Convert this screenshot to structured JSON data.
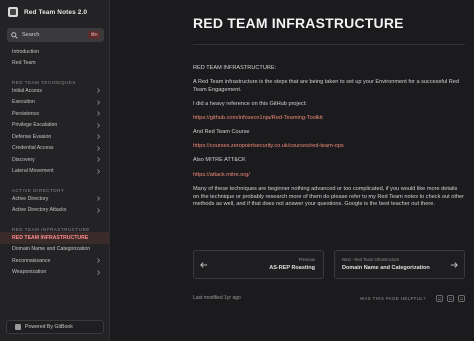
{
  "app": {
    "title": "Red Team Notes 2.0"
  },
  "search": {
    "label": "Search",
    "shortcut": "⌘K"
  },
  "sidebar": {
    "top_items": [
      {
        "label": "Introduction"
      },
      {
        "label": "Red Team"
      }
    ],
    "sections": [
      {
        "title": "RED TEAM TECHNIQUES",
        "items": [
          {
            "label": "Initial Access"
          },
          {
            "label": "Execution"
          },
          {
            "label": "Persistence"
          },
          {
            "label": "Privilege Escalation"
          },
          {
            "label": "Defense Evasion"
          },
          {
            "label": "Credential Access"
          },
          {
            "label": "Discovery"
          },
          {
            "label": "Lateral Movement"
          }
        ]
      },
      {
        "title": "ACTIVE DIRECTORY",
        "items": [
          {
            "label": "Active Directory"
          },
          {
            "label": "Active Directory Attacks"
          }
        ]
      },
      {
        "title": "RED TEAM INFRASTRUCTURE",
        "items": [
          {
            "label": "RED TEAM INFRASTRUCTURE",
            "active": true
          },
          {
            "label": "Domain Name and Categorization"
          },
          {
            "label": "Reconnaissance"
          },
          {
            "label": "Weaponization"
          }
        ]
      }
    ],
    "powered_by": "Powered By GitBook"
  },
  "page": {
    "title": "RED TEAM INFRASTRUCTURE",
    "paragraphs": [
      "RED TEAM INFRASTRUCTURE:",
      "A Red Team infrastructure is the steps that are being taken to set up your Environment for a successful Red Team Engagement.",
      "I did a heavy reference on this GitHub project:",
      "https://github.com/infosecn1nja/Red-Teaming-Toolkit",
      "And Red Team Course",
      "https://courses.zeropointsecurity.co.uk/courses/red-team-ops",
      "Also MITRE ATT&CK",
      "https://attack.mitre.org/",
      "Many of these techniques are beginner nothing advanced or too complicated, if you would like more details on the technique or probably research more of them do please refer to my Red Team notes to check out other methods as well, and if that does not answer your questions. Google is the best teacher out there."
    ]
  },
  "pager": {
    "prev": {
      "meta": "Previous",
      "title": "AS-REP Roasting"
    },
    "next": {
      "meta": "Next - Red Team Infrastructure",
      "title": "Domain Name and Categorization"
    }
  },
  "footer": {
    "modified": "Last modified 1yr ago",
    "helpful": "WAS THIS PAGE HELPFUL?"
  },
  "colors": {
    "accent": "#f08a7a",
    "active_bg": "#3a2a2a",
    "background": "#1b1b1d"
  }
}
